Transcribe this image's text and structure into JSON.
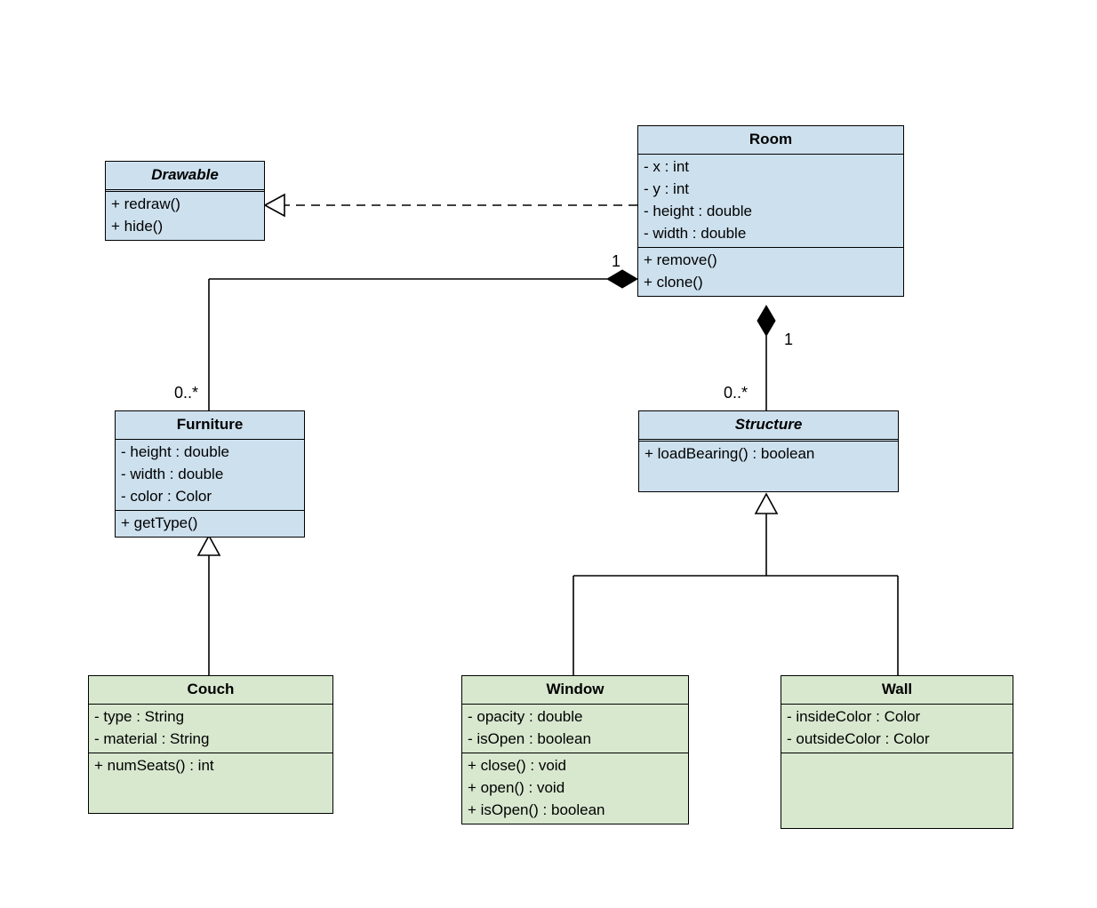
{
  "classes": {
    "drawable": {
      "name": "Drawable",
      "ops": [
        "+ redraw()",
        "+ hide()"
      ]
    },
    "room": {
      "name": "Room",
      "attrs": [
        "- x : int",
        "- y : int",
        "- height : double",
        "- width : double"
      ],
      "ops": [
        "+ remove()",
        "+ clone()"
      ]
    },
    "furniture": {
      "name": "Furniture",
      "attrs": [
        "- height : double",
        "- width : double",
        "- color : Color"
      ],
      "ops": [
        "+ getType()"
      ]
    },
    "structure": {
      "name": "Structure",
      "ops": [
        "+ loadBearing() : boolean"
      ]
    },
    "couch": {
      "name": "Couch",
      "attrs": [
        "- type : String",
        "- material : String"
      ],
      "ops": [
        "+ numSeats() : int"
      ]
    },
    "window": {
      "name": "Window",
      "attrs": [
        "- opacity : double",
        "- isOpen : boolean"
      ],
      "ops": [
        "+ close() : void",
        "+ open() : void",
        "+ isOpen() : boolean"
      ]
    },
    "wall": {
      "name": "Wall",
      "attrs": [
        "- insideColor : Color",
        "- outsideColor : Color"
      ]
    }
  },
  "multiplicities": {
    "room_furniture_room": "1",
    "room_furniture_furniture": "0..*",
    "room_structure_room": "1",
    "room_structure_structure": "0..*"
  },
  "relationships": [
    {
      "from": "Room",
      "to": "Drawable",
      "type": "realization"
    },
    {
      "from": "Room",
      "to": "Furniture",
      "type": "composition",
      "src": "1",
      "dst": "0..*"
    },
    {
      "from": "Room",
      "to": "Structure",
      "type": "composition",
      "src": "1",
      "dst": "0..*"
    },
    {
      "from": "Couch",
      "to": "Furniture",
      "type": "generalization"
    },
    {
      "from": "Window",
      "to": "Structure",
      "type": "generalization"
    },
    {
      "from": "Wall",
      "to": "Structure",
      "type": "generalization"
    }
  ]
}
